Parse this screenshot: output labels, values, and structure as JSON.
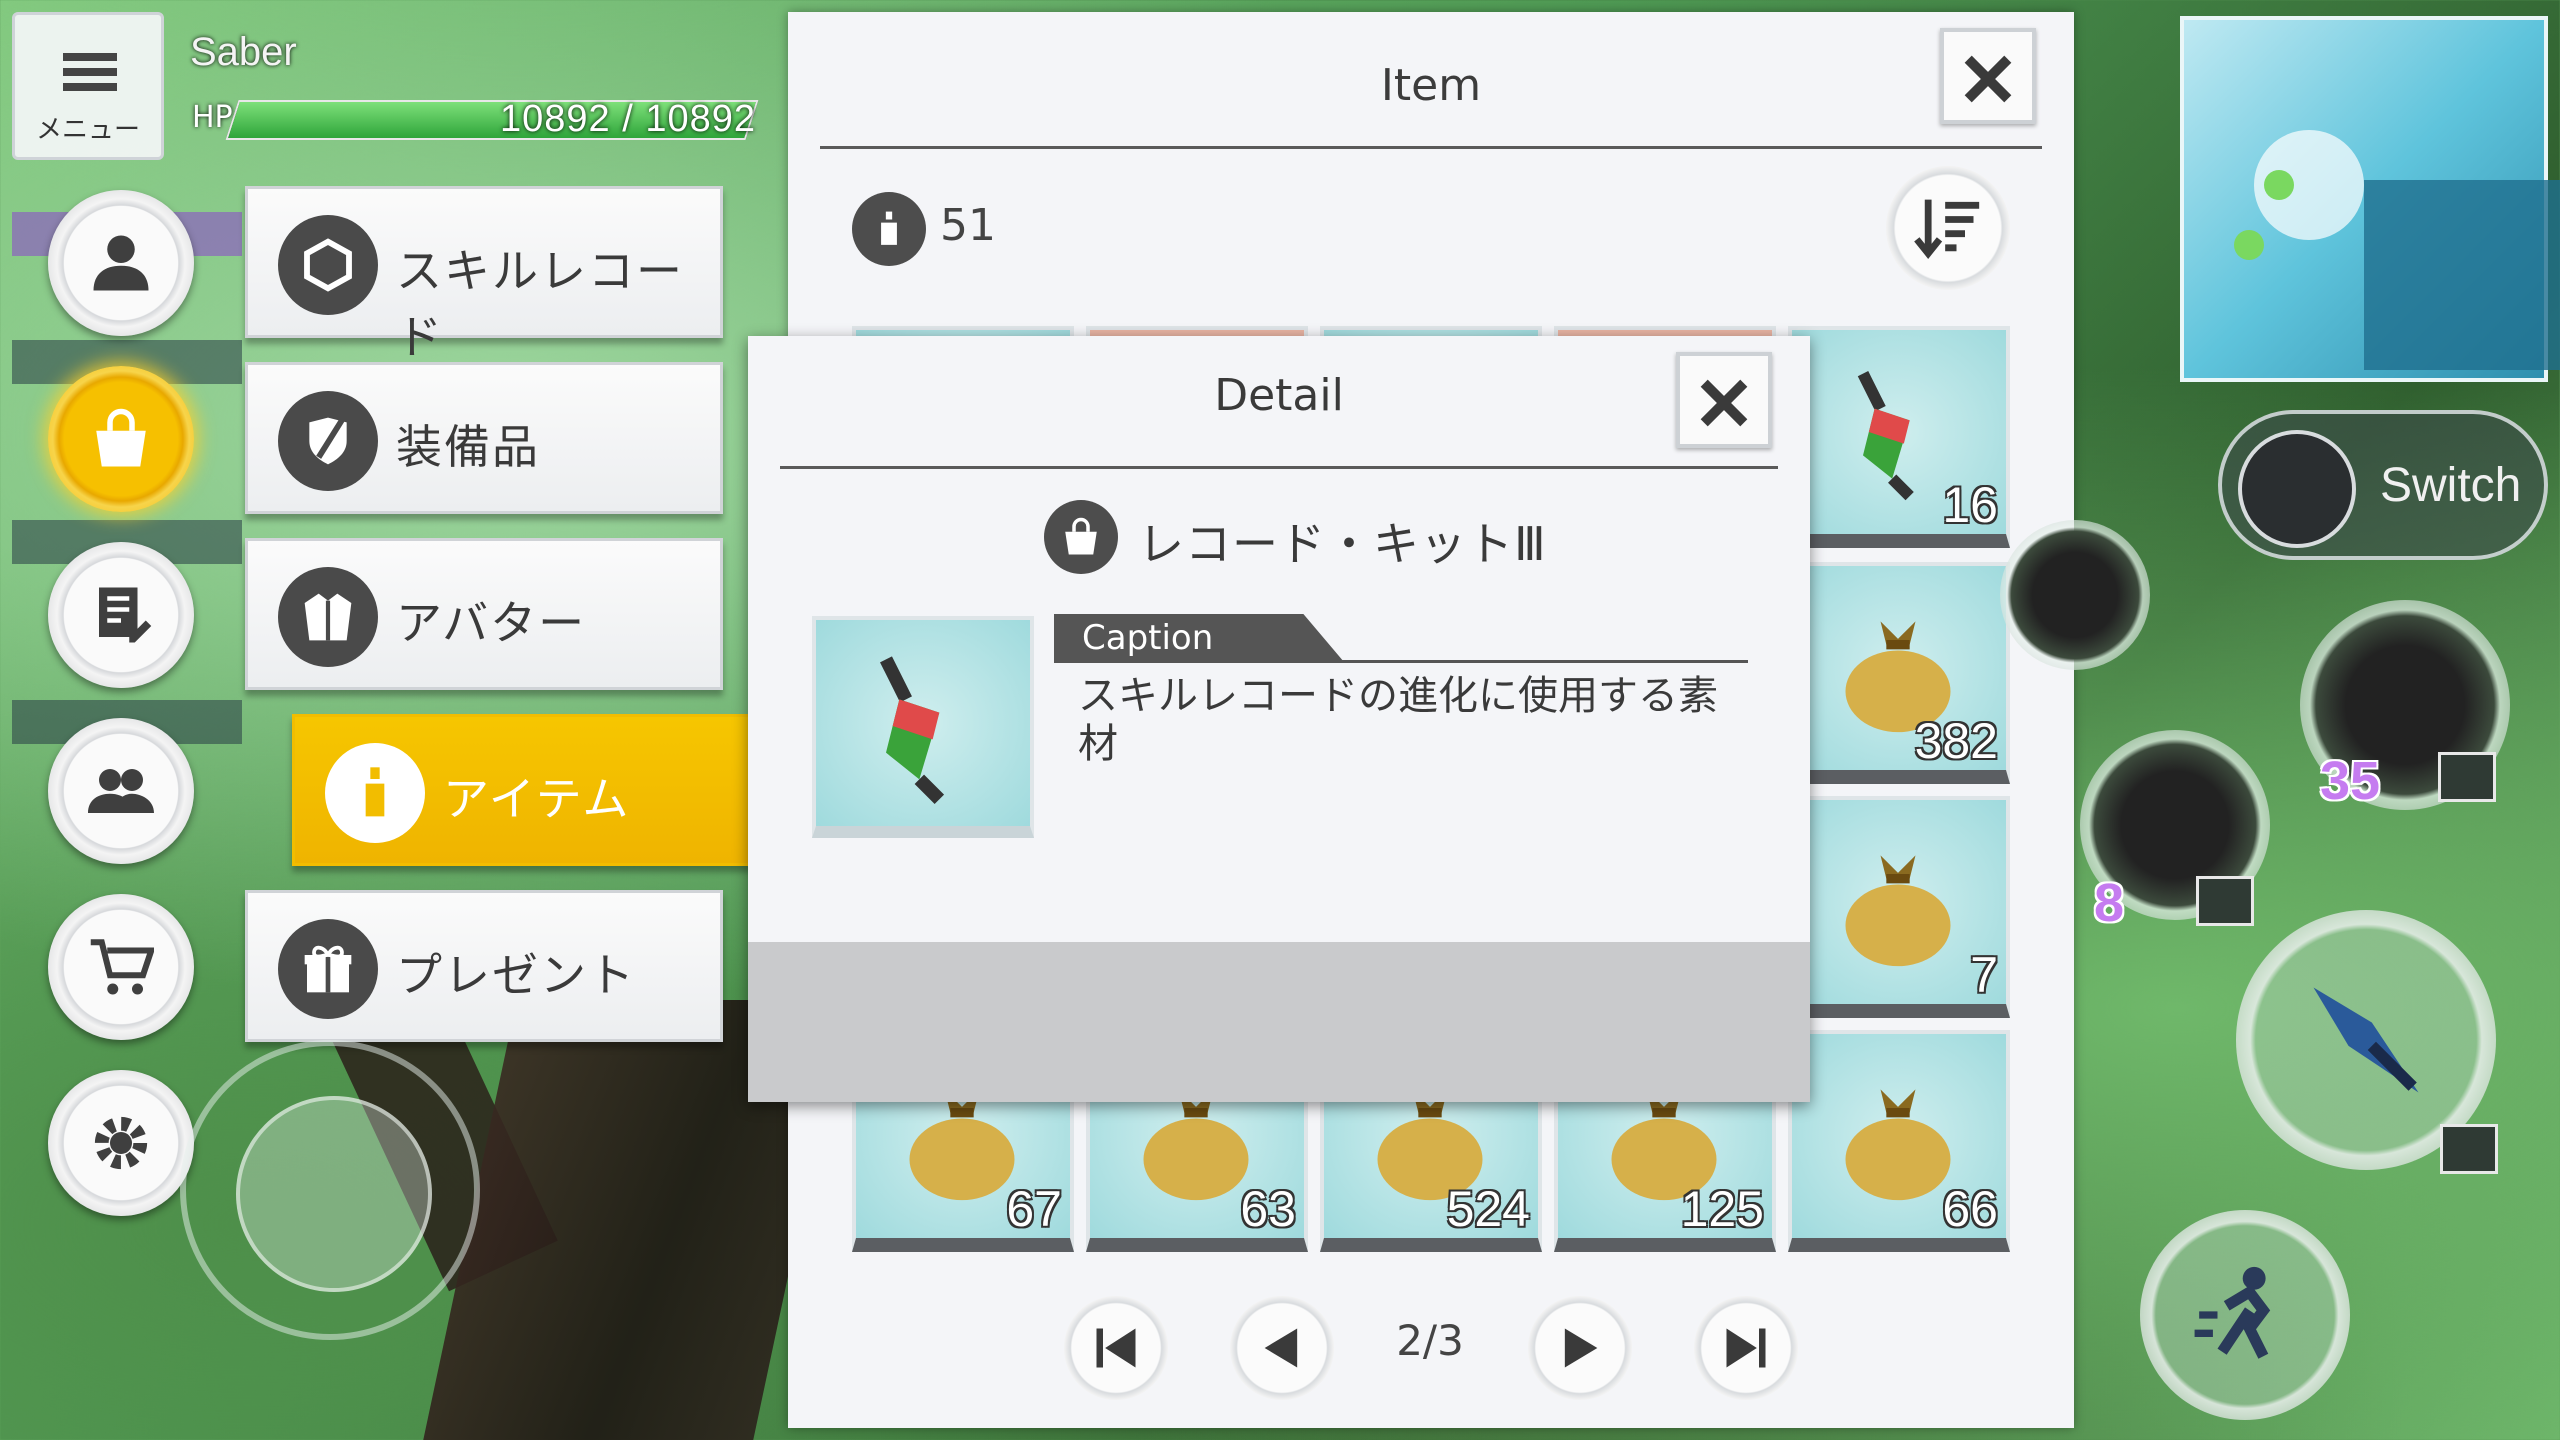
{
  "player": {
    "menu_label": "メニュー",
    "name": "Saber",
    "hp_label": "HP",
    "hp_text": "10892 / 10892",
    "hp_fraction": 1.0
  },
  "side_menu": {
    "active": "item",
    "submenu": [
      "スキルレコード",
      "装備品",
      "アバター",
      "アイテム",
      "プレゼント"
    ]
  },
  "item_panel": {
    "title": "Item",
    "count": "51",
    "grid_counts": [
      "16",
      "382",
      "7",
      "67",
      "63",
      "524",
      "125",
      "66"
    ],
    "page": "2/3"
  },
  "detail": {
    "title": "Detail",
    "item_name": "レコード・キットⅢ",
    "caption_label": "Caption",
    "caption_text": "スキルレコードの進化に使用する素材"
  },
  "hud": {
    "switch_label": "Switch",
    "skill_count_1": "35",
    "skill_count_2": "8"
  },
  "colors": {
    "accent_yellow": "#f2bd00",
    "hp_green": "#2ea53a",
    "panel_bg": "#f4f5f8"
  }
}
